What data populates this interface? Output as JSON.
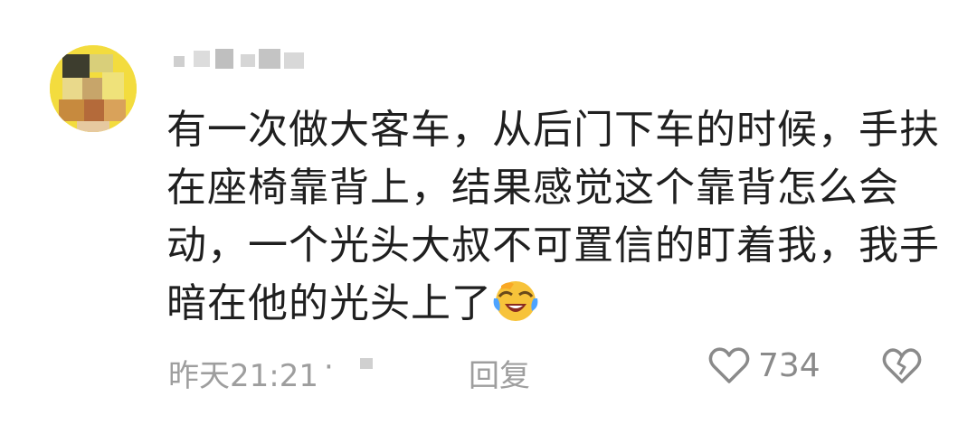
{
  "comment": {
    "text": "有一次做大客车，从后门下车的时候，手扶在座椅靠背上，结果感觉这个靠背怎么会动，一个光头大叔不可置信的盯着我，我手暗在他的光头上了"
  },
  "footer": {
    "time": "昨天21:21",
    "separator": "·",
    "reply_label": "回复",
    "like_count": "734"
  },
  "icons": {
    "emoji": "laughing-crying-emoji-icon",
    "like": "heart-outline-icon",
    "dislike": "broken-heart-icon"
  },
  "colors": {
    "text": "#1f1f1f",
    "meta": "#9e9e9e",
    "avatar_bg": "#f4e04a"
  }
}
